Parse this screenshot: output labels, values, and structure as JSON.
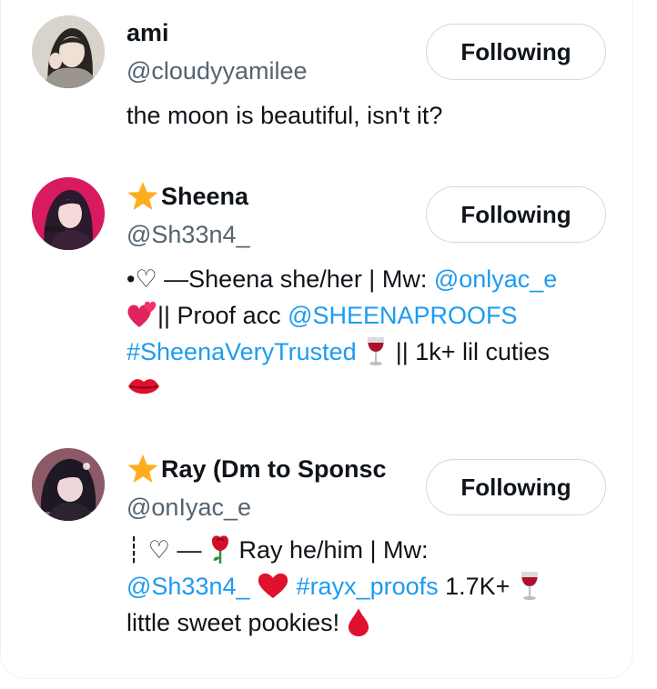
{
  "users": [
    {
      "name": "ami",
      "handle": "@cloudyyamilee",
      "button": "Following",
      "bio": "the moon is beautiful, isn't it?"
    },
    {
      "name": "Sheena",
      "handle": "@Sh33n4_",
      "button": "Following",
      "bio_parts": {
        "p1": "•♡ —Sheena she/her | Mw: ",
        "link1": "@onlyac_e",
        "p2": "|| Proof acc ",
        "link2": "@SHEENAPROOFS",
        "link3": "#SheenaVeryTrusted",
        "p3": " || 1k+ lil cuties"
      }
    },
    {
      "name": "Ray (Dm to Sponsc",
      "handle": "@onIyac_e",
      "button": "Following",
      "bio_parts": {
        "p1": "┊ ♡ — ",
        "p2": " Ray he/him | Mw:",
        "link1": "@Sh33n4_",
        "link2": "#rayx_proofs",
        "p3": " 1.7K+ ",
        "p4": "little sweet pookies! "
      }
    }
  ],
  "colors": {
    "link": "#1d9bf0",
    "secondary_text": "#536471",
    "button_border": "#cfd9de",
    "star": "#ffad1f"
  }
}
